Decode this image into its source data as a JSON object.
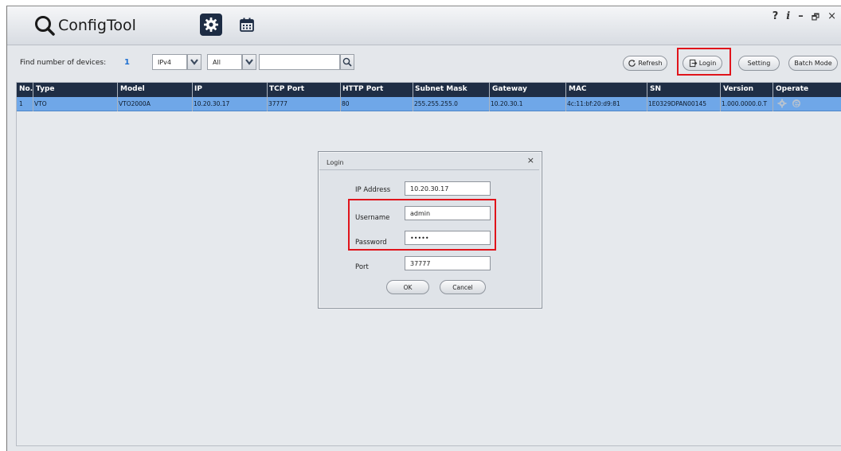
{
  "app": {
    "title": "ConfigTool",
    "nav": [
      {
        "icon": "gear-icon",
        "active": true
      },
      {
        "icon": "calendar-icon",
        "active": false
      }
    ],
    "window_controls": [
      "?",
      "i",
      "–",
      "🗗",
      "×"
    ]
  },
  "toolbar": {
    "find_label": "Find number of devices:",
    "device_count": "1",
    "protocol_value": "IPv4",
    "filter_value": "All",
    "search_value": "",
    "refresh_label": "Refresh",
    "login_label": "Login",
    "setting_label": "Setting",
    "batch_label": "Batch Mode"
  },
  "table": {
    "headers": [
      "No.",
      "Type",
      "Model",
      "IP",
      "TCP Port",
      "HTTP Port",
      "Subnet Mask",
      "Gateway",
      "MAC",
      "SN",
      "Version",
      "Operate"
    ],
    "rows": [
      [
        "1",
        "VTO",
        "VTO2000A",
        "10.20.30.17",
        "37777",
        "80",
        "255.255.255.0",
        "10.20.30.1",
        "4c:11:bf:20:d9:81",
        "1E0329DPAN00145",
        "1.000.0000.0.T",
        ""
      ]
    ]
  },
  "login_dialog": {
    "title": "Login",
    "close": "×",
    "ip_label": "IP Address",
    "ip_value": "10.20.30.17",
    "username_label": "Username",
    "username_value": "admin",
    "password_label": "Password",
    "password_value": "•••••",
    "port_label": "Port",
    "port_value": "37777",
    "ok_label": "OK",
    "cancel_label": "Cancel"
  },
  "colors": {
    "header_bg": "#1f2e45",
    "selected_row": "#6fa7e8",
    "highlight_box": "#e0141b",
    "count_text": "#1d6fd1"
  }
}
